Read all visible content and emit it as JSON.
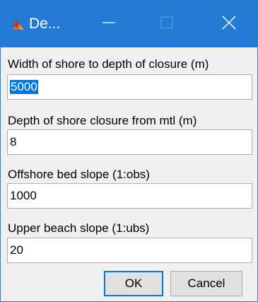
{
  "window": {
    "title": "De...",
    "accent": "#2479d3"
  },
  "titlebar": {
    "app_icon": "matlab-icon",
    "minimize_icon": "minimize-icon",
    "maximize_icon": "maximize-icon",
    "close_icon": "close-icon"
  },
  "fields": [
    {
      "label": "Width of shore to depth of closure (m)",
      "value": "5000"
    },
    {
      "label": "Depth of shore closure from mtl (m)",
      "value": "8"
    },
    {
      "label": "Offshore bed slope (1:obs)",
      "value": "1000"
    },
    {
      "label": "Upper beach slope (1:ubs)",
      "value": "20"
    }
  ],
  "buttons": {
    "ok_label": "OK",
    "cancel_label": "Cancel"
  }
}
